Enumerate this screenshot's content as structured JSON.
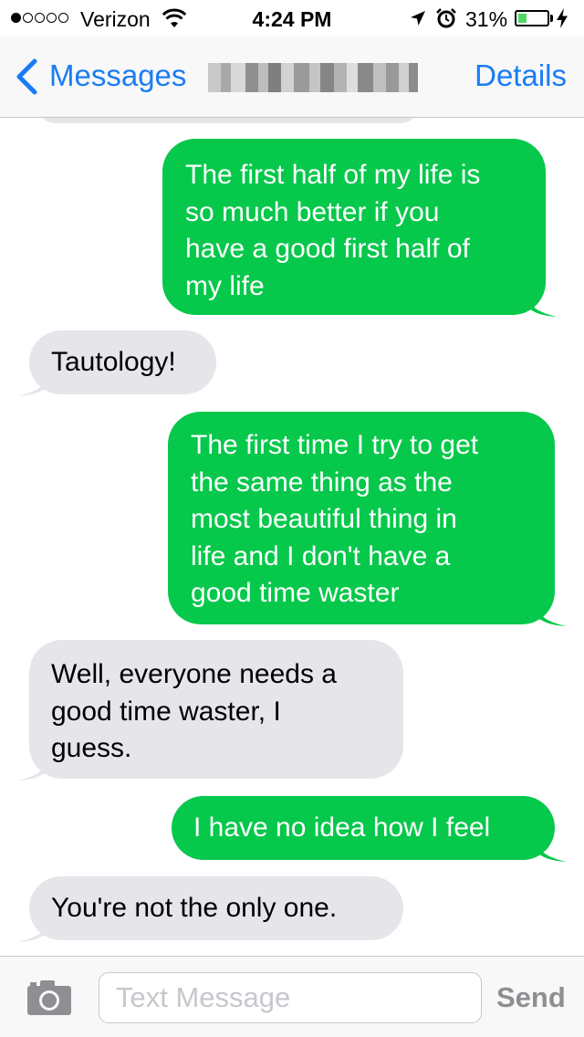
{
  "status_bar": {
    "carrier": "Verizon",
    "signal_bars": 1,
    "signal_max": 5,
    "time": "4:24 PM",
    "battery_text": "31%",
    "battery_level": 0.31,
    "icons": [
      "wifi-icon",
      "location-arrow-icon",
      "alarm-clock-icon",
      "battery-icon",
      "charging-bolt-icon"
    ]
  },
  "nav": {
    "back_label": "Messages",
    "details_label": "Details",
    "contact_name_pixelated": true
  },
  "messages": [
    {
      "direction": "outgoing",
      "text": "The first half of my life is so much better if you have a good first half of my life",
      "lines": [
        "The first half of my life is",
        "so much better if you",
        "have a good first half of",
        "my life"
      ]
    },
    {
      "direction": "incoming",
      "text": "Tautology!",
      "lines": [
        "Tautology!"
      ]
    },
    {
      "direction": "outgoing",
      "text": "The first time I try to get the same thing as the most beautiful thing in life and I don't have a good time waster",
      "lines": [
        "The first time I try to get",
        "the same thing as the",
        "most beautiful thing in",
        "life and I don't have a",
        "good time waster"
      ]
    },
    {
      "direction": "incoming",
      "text": "Well, everyone needs a good time waster, I guess.",
      "lines": [
        "Well, everyone needs a",
        "good time waster, I",
        "guess."
      ]
    },
    {
      "direction": "outgoing",
      "text": "I have no idea how I feel",
      "lines": [
        "I have no idea how I feel"
      ]
    },
    {
      "direction": "incoming",
      "text": "You're not the only one.",
      "lines": [
        "You're not the only one."
      ]
    }
  ],
  "input_bar": {
    "placeholder": "Text Message",
    "value": "",
    "send_label": "Send",
    "camera_icon": "camera-icon"
  },
  "colors": {
    "outgoing_bubble": "#06c84b",
    "incoming_bubble": "#e5e5ea",
    "accent": "#1a7cf5",
    "send_disabled": "#8e8e93"
  }
}
